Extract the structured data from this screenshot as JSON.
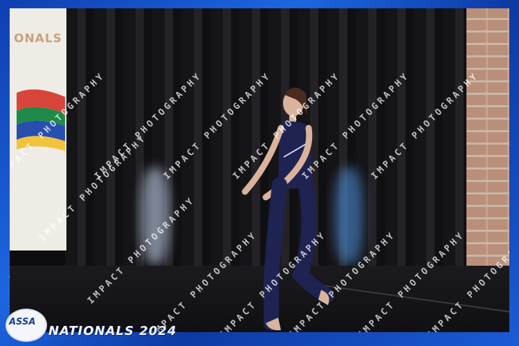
{
  "banner": {
    "text": "ONALS"
  },
  "watermark": {
    "text": "IMPACT PHOTOGRAPHY"
  },
  "logo": {
    "text": "ASSA"
  },
  "event": {
    "title": "NATIONALS 2024"
  },
  "colors": {
    "frame": "#1553c8",
    "accent": "#f2d24a",
    "costume": "#1f2352"
  }
}
